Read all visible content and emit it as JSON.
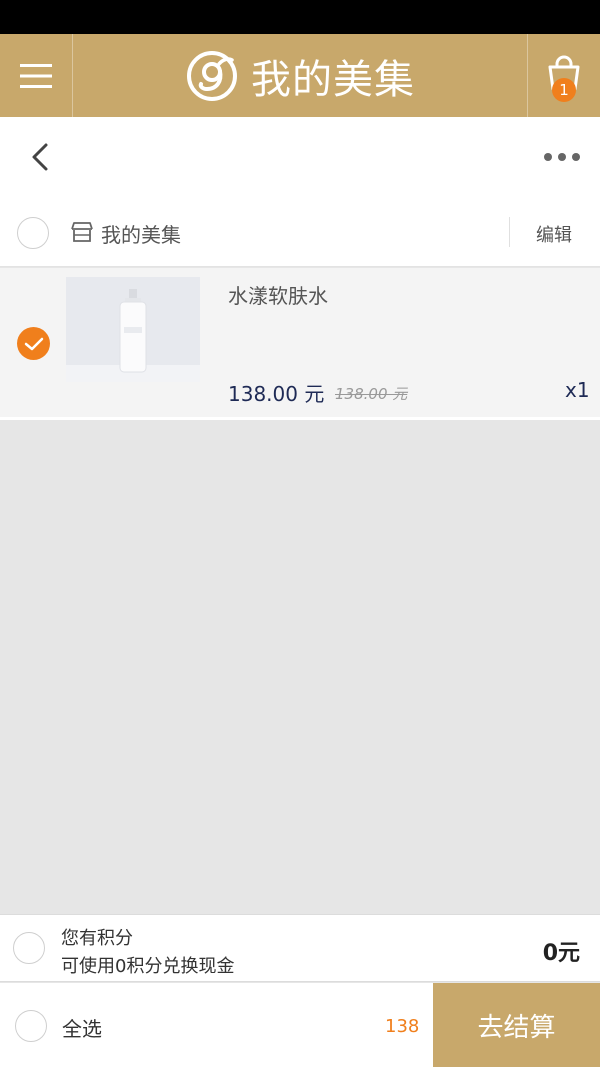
{
  "header": {
    "brand_title": "我的美集",
    "cart_count": "1"
  },
  "shop": {
    "name": "我的美集",
    "edit_label": "编辑"
  },
  "cart_items": [
    {
      "name": "水漾软肤水",
      "price": "138.00 元",
      "original_price": "138.00 元",
      "quantity": "x1",
      "selected": true
    }
  ],
  "points": {
    "title": "您有积分",
    "description": "可使用0积分兑换现金",
    "value": "0元"
  },
  "footer": {
    "select_all_label": "全选",
    "total": "138",
    "checkout_label": "去结算"
  },
  "colors": {
    "brand_gold": "#c8a86b",
    "accent_orange": "#f07f1c",
    "price_navy": "#1e2a55"
  }
}
